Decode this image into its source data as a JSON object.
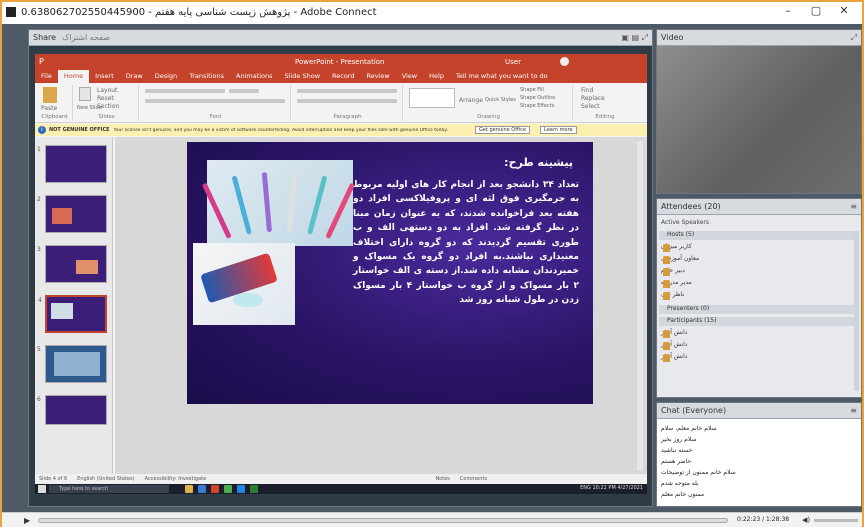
{
  "window": {
    "title": "0.638062702550445900 - پژوهش زیست شناسی پایه هفتم - Adobe Connect",
    "minimize": "–",
    "maximize": "▢",
    "close": "✕"
  },
  "pods": {
    "share": {
      "title": "Share",
      "subtitle": "صفحه اشتراک"
    },
    "video": {
      "title": "Video"
    },
    "attendees": {
      "title": "Attendees (20)",
      "active_speakers": "Active Speakers",
      "hosts_label": "Hosts (5)",
      "presenters_label": "Presenters (0)",
      "participants_label": "Participants (15)"
    },
    "chat": {
      "title": "Chat (Everyone)"
    }
  },
  "attendees": {
    "hosts": [
      "کاربر میزبان",
      "معاون آموزشی",
      "دبیر علوم",
      "مدیر مدرسه",
      "ناظر فنی"
    ],
    "participants": [
      "دانش آموز",
      "دانش آموز",
      "دانش آموز"
    ]
  },
  "chat": {
    "messages": [
      "سلام خانم معلم، سلام",
      "سلام روز بخیر",
      "خسته نباشید",
      "حاضر هستم",
      "سلام خانم ممنون از توضیحات",
      "بله متوجه شدم",
      "ممنون خانم معلم"
    ]
  },
  "powerpoint": {
    "title_bar": "PowerPoint - Presentation",
    "user": "User",
    "tabs": [
      "File",
      "Home",
      "Insert",
      "Draw",
      "Design",
      "Transitions",
      "Animations",
      "Slide Show",
      "Record",
      "Review",
      "View",
      "Help",
      "Tell me what you want to do"
    ],
    "ribbon_groups": [
      "Clipboard",
      "Slides",
      "Font",
      "Paragraph",
      "Drawing",
      "Editing"
    ],
    "ribbon_labels": {
      "paste": "Paste",
      "new_slide": "New Slide",
      "find": "Find",
      "replace": "Replace",
      "select": "Select",
      "arrange": "Arrange",
      "quick_styles": "Quick Styles",
      "layout": "Layout",
      "reset": "Reset",
      "section": "Section",
      "shape_fill": "Shape Fill",
      "shape_outline": "Shape Outline",
      "shape_effects": "Shape Effects"
    },
    "warning": {
      "label": "NOT GENUINE OFFICE",
      "text": "Your license isn't genuine, and you may be a victim of software counterfeiting. Avoid interruption and keep your files safe with genuine Office today.",
      "button1": "Get genuine Office",
      "button2": "Learn more"
    },
    "thumbnails": [
      "1",
      "2",
      "3",
      "4",
      "5",
      "6"
    ],
    "slide": {
      "title": "پیشینه طرح:",
      "body": "تعداد ۳۴ دانشجو بعد از انجام کار های اولیه مربوط به جرمگیری فوق لثه ای و پروفیلاکسی افراد دو هفته بعد فراخوانده شدند، که به عنوان زمان مبنا در نظر گرفته شد. افراد به دو دستهی الف و ب طوری تقسیم گردیدند که دو گروه دارای اختلاف معنیداری نباشند.به افراد دو گروه یک مسواک و خمیردندان مشابه داده شد.از دسته ی الف خواستار ۲ بار مسواک و از گروه ب خواستار ۴ بار مسواک زدن در طول شبانه روز شد"
    },
    "status": {
      "slide_info": "Slide 4 of 6",
      "language": "English (United States)",
      "accessibility": "Accessibility: Investigate",
      "notes": "Notes",
      "comments": "Comments"
    }
  },
  "taskbar": {
    "search_placeholder": "Type here to search",
    "time": "10:22 PM",
    "date": "4/27/2021",
    "lang": "ENG"
  },
  "playback": {
    "time": "0:22:23 / 1:28:38"
  },
  "colors": {
    "accent": "#c4432a",
    "slide_bg": "#2a1466",
    "frame": "#e8a33a"
  }
}
